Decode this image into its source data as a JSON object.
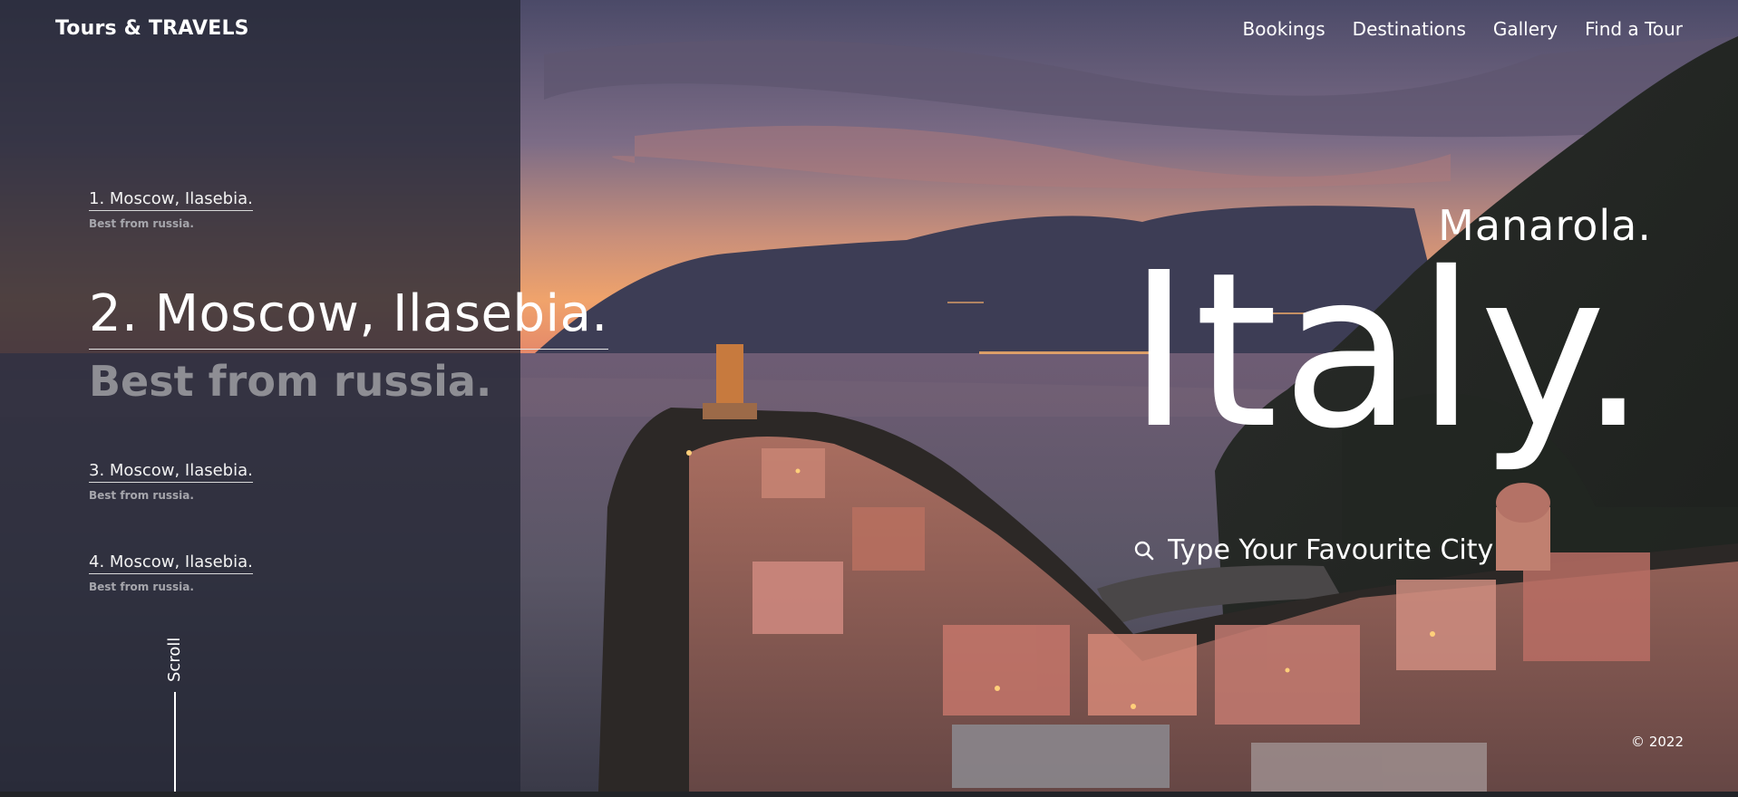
{
  "header": {
    "logo": "Tours & TRAVELS",
    "nav": [
      "Bookings",
      "Destinations",
      "Gallery",
      "Find a Tour"
    ]
  },
  "destinations": [
    {
      "title": "1. Moscow, Ilasebia.",
      "subtitle": "Best from russia.",
      "active": false
    },
    {
      "title": "2. Moscow, Ilasebia.",
      "subtitle": "Best from russia.",
      "active": true
    },
    {
      "title": "3. Moscow, Ilasebia.",
      "subtitle": "Best from russia.",
      "active": false
    },
    {
      "title": "4. Moscow, Ilasebia.",
      "subtitle": "Best from russia.",
      "active": false
    }
  ],
  "scroll": {
    "label": "Scroll"
  },
  "hero": {
    "subtitle": "Manarola.",
    "title": "Italy.",
    "search_placeholder": "Type Your Favourite City"
  },
  "footer": {
    "copyright": "© 2022"
  },
  "icons": {
    "search": "search-icon"
  },
  "colors": {
    "overlay": "#262836",
    "text": "#ffffff",
    "muted": "#8e8e94"
  }
}
